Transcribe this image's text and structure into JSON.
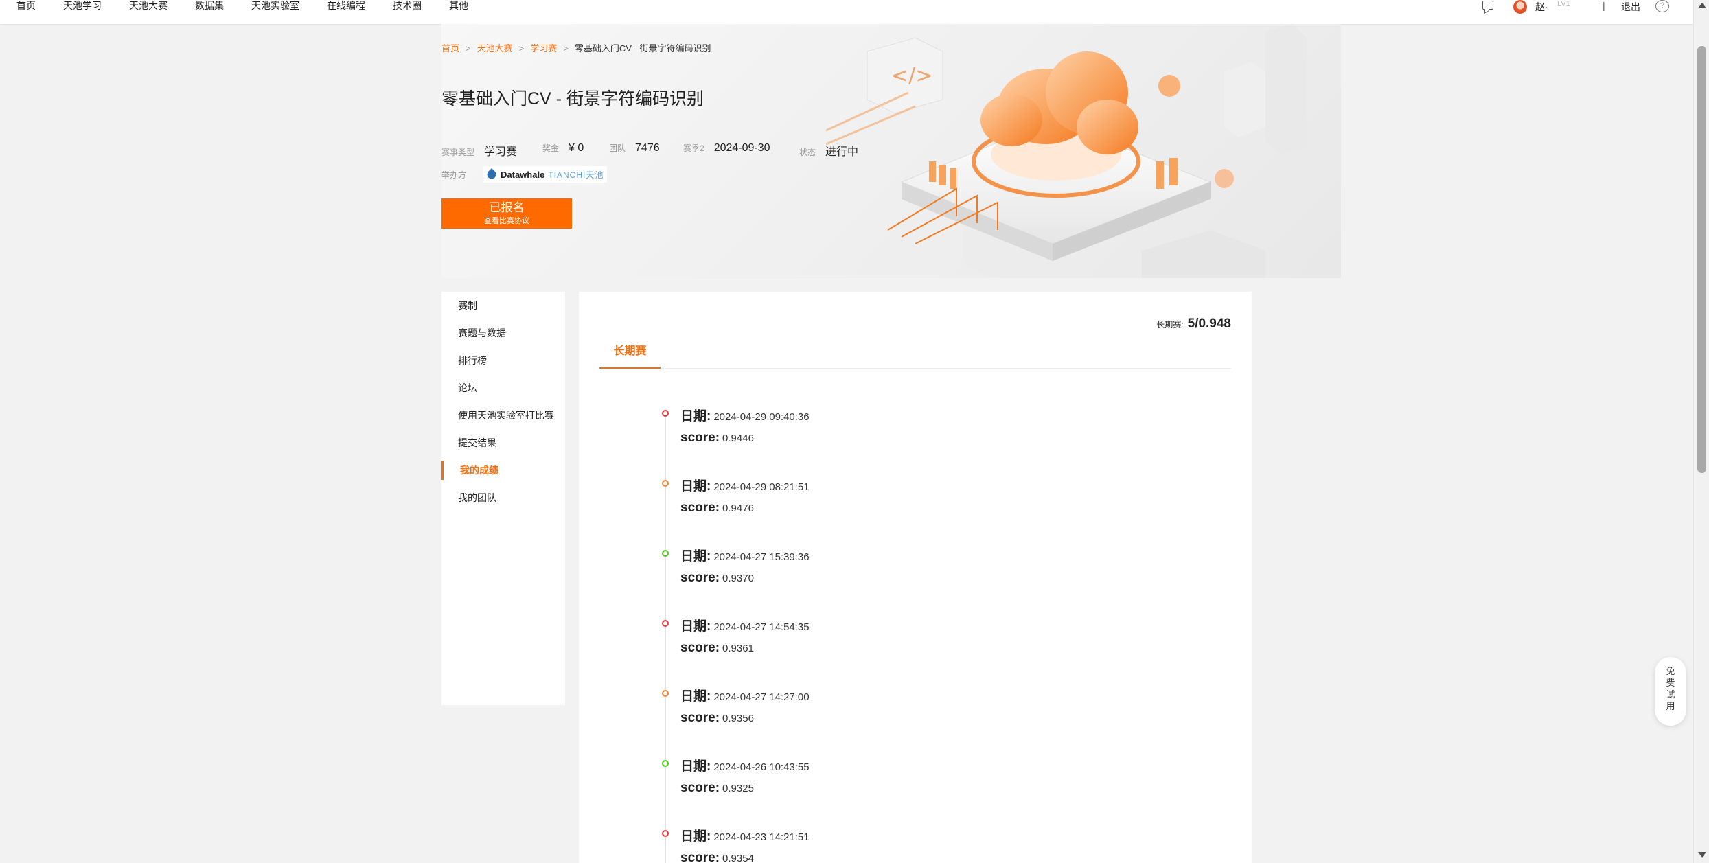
{
  "nav": {
    "items": [
      "首页",
      "天池学习",
      "天池大赛",
      "数据集",
      "天池实验室",
      "在线编程",
      "技术圈",
      "其他"
    ],
    "user": {
      "name": "赵·",
      "level_badge": "LV1",
      "separator": "|",
      "logout": "退出"
    }
  },
  "breadcrumb": {
    "items": [
      "首页",
      "天池大赛",
      "学习赛"
    ],
    "separator": ">",
    "current": "零基础入门CV - 街景字符编码识别"
  },
  "competition": {
    "title": "零基础入门CV - 街景字符编码识别",
    "meta": [
      {
        "label": "赛事类型",
        "value": "学习赛"
      },
      {
        "label": "奖金",
        "value": "¥ 0"
      },
      {
        "label": "团队",
        "value": "7476"
      },
      {
        "label": "赛季2",
        "value": "2024-09-30"
      },
      {
        "label": "状态",
        "value": "进行中"
      }
    ],
    "organizer_label": "举办方",
    "organizers": {
      "datawhale": "Datawhale",
      "tianchi": "TIANCHI天池"
    },
    "signup_button": {
      "status": "已报名",
      "agreement": "查看比赛协议"
    }
  },
  "sidebar": {
    "items": [
      "赛制",
      "赛题与数据",
      "排行榜",
      "论坛",
      "使用天池实验室打比赛",
      "提交结果",
      "我的成绩",
      "我的团队"
    ],
    "active_index": 6
  },
  "results": {
    "best_label": "长期赛:",
    "best_value": "5/0.948",
    "tab": "长期赛",
    "date_key": "日期:",
    "score_key": "score:",
    "entries": [
      {
        "date": "2024-04-29 09:40:36",
        "score": "0.9446",
        "dot": "red"
      },
      {
        "date": "2024-04-29 08:21:51",
        "score": "0.9476",
        "dot": "orange"
      },
      {
        "date": "2024-04-27 15:39:36",
        "score": "0.9370",
        "dot": "green"
      },
      {
        "date": "2024-04-27 14:54:35",
        "score": "0.9361",
        "dot": "red"
      },
      {
        "date": "2024-04-27 14:27:00",
        "score": "0.9356",
        "dot": "orange"
      },
      {
        "date": "2024-04-26 10:43:55",
        "score": "0.9325",
        "dot": "green"
      },
      {
        "date": "2024-04-23 14:21:51",
        "score": "0.9354",
        "dot": "red"
      }
    ]
  },
  "float_trial": {
    "label": "免费试用"
  },
  "colors": {
    "accent": "#f26f12",
    "button": "#ff6a00"
  }
}
